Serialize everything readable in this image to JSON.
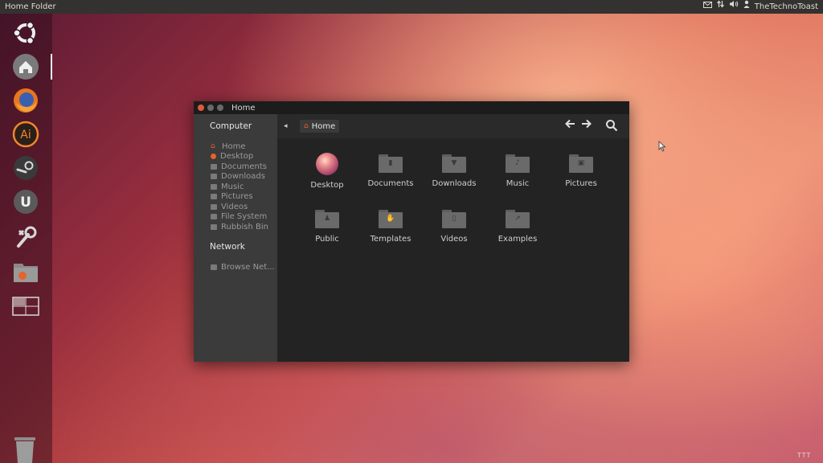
{
  "panel": {
    "app_title": "Home Folder",
    "user_name": "TheTechnoToast",
    "tray_icons": [
      "mail-icon",
      "network-icon",
      "volume-icon",
      "user-icon"
    ]
  },
  "launcher": {
    "items": [
      "ubuntu-logo-icon",
      "home-folder-icon",
      "firefox-icon",
      "illustrator-icon",
      "steam-icon",
      "ubuntu-one-icon",
      "system-settings-icon",
      "files-folder-icon",
      "workspace-switcher-icon"
    ],
    "ai_label": "Ai",
    "u_label": "U",
    "trash": "trash-icon"
  },
  "window": {
    "title": "Home",
    "sidebar": {
      "computer_heading": "Computer",
      "places": [
        "Home",
        "Desktop",
        "Documents",
        "Downloads",
        "Music",
        "Pictures",
        "Videos",
        "File System",
        "Rubbish Bin"
      ],
      "network_heading": "Network",
      "network_items": [
        "Browse Net..."
      ]
    },
    "toolbar": {
      "back_glyph": "◂",
      "breadcrumb": "Home"
    },
    "files": [
      "Desktop",
      "Documents",
      "Downloads",
      "Music",
      "Pictures",
      "Public",
      "Templates",
      "Videos",
      "Examples"
    ]
  },
  "watermark": "TTT",
  "colors": {
    "accent": "#e5632d",
    "panel_bg": "#333230",
    "sidebar_bg": "#3b3b3b",
    "content_bg": "#232323"
  }
}
